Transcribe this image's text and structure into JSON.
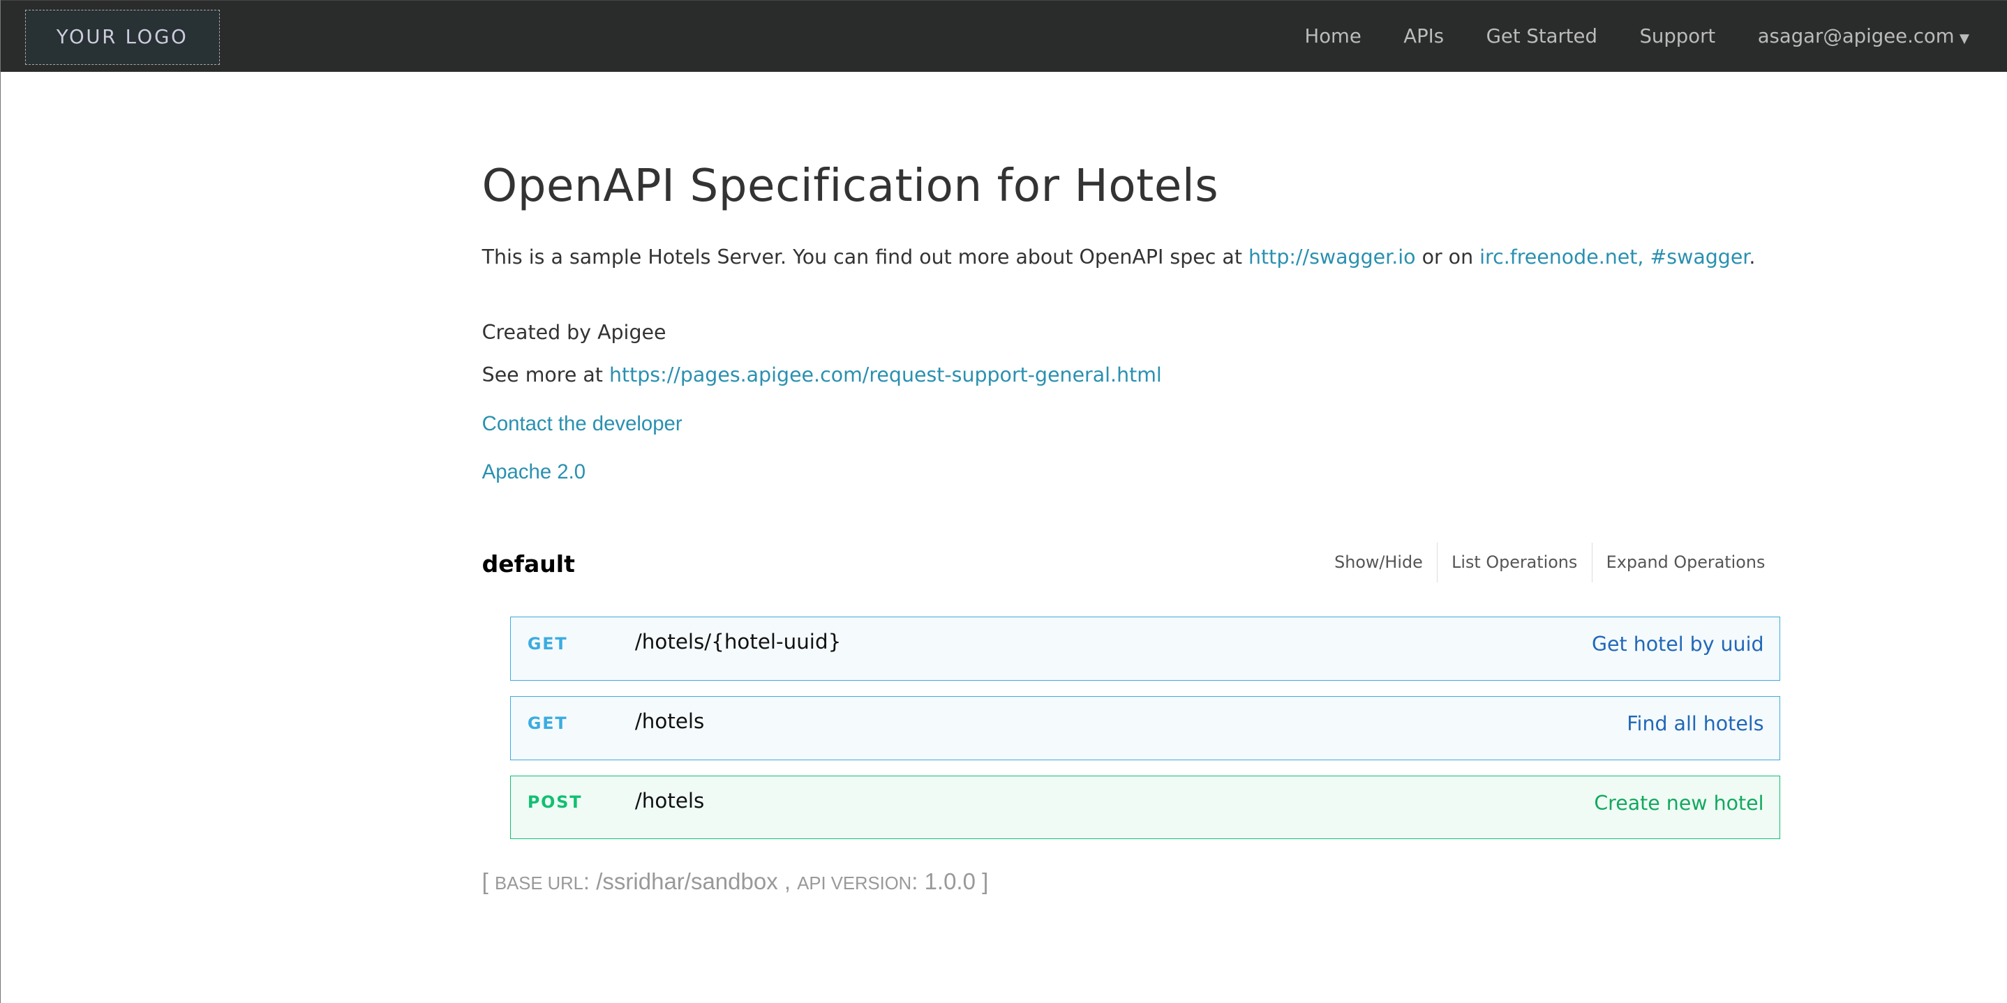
{
  "navbar": {
    "logo": "YOUR LOGO",
    "items": [
      "Home",
      "APIs",
      "Get Started",
      "Support"
    ],
    "user": "asagar@apigee.com"
  },
  "info": {
    "title": "OpenAPI Specification for Hotels",
    "desc_prefix": "This is a sample Hotels Server. You can find out more about OpenAPI spec at ",
    "link1": "http://swagger.io",
    "desc_mid": " or on ",
    "link2": "irc.freenode.net, #swagger",
    "desc_suffix": ".",
    "created_by": "Created by Apigee",
    "see_more_prefix": "See more at ",
    "see_more_link": "https://pages.apigee.com/request-support-general.html",
    "contact": "Contact the developer",
    "license": "Apache 2.0"
  },
  "resource": {
    "name": "default",
    "controls": [
      "Show/Hide",
      "List Operations",
      "Expand Operations"
    ],
    "operations": [
      {
        "method": "GET",
        "path": "/hotels/{hotel-uuid}",
        "summary": "Get hotel by uuid"
      },
      {
        "method": "GET",
        "path": "/hotels",
        "summary": "Find all hotels"
      },
      {
        "method": "POST",
        "path": "/hotels",
        "summary": "Create new hotel"
      }
    ]
  },
  "footer": {
    "base_url_label": "Base URL",
    "base_url": "/ssridhar/sandbox",
    "api_version_label": "API Version",
    "api_version": "1.0.0"
  },
  "colors": {
    "get": "#3bace0",
    "post": "#10c071",
    "navbar": "#2a2c2b",
    "link": "#2a90b0"
  }
}
